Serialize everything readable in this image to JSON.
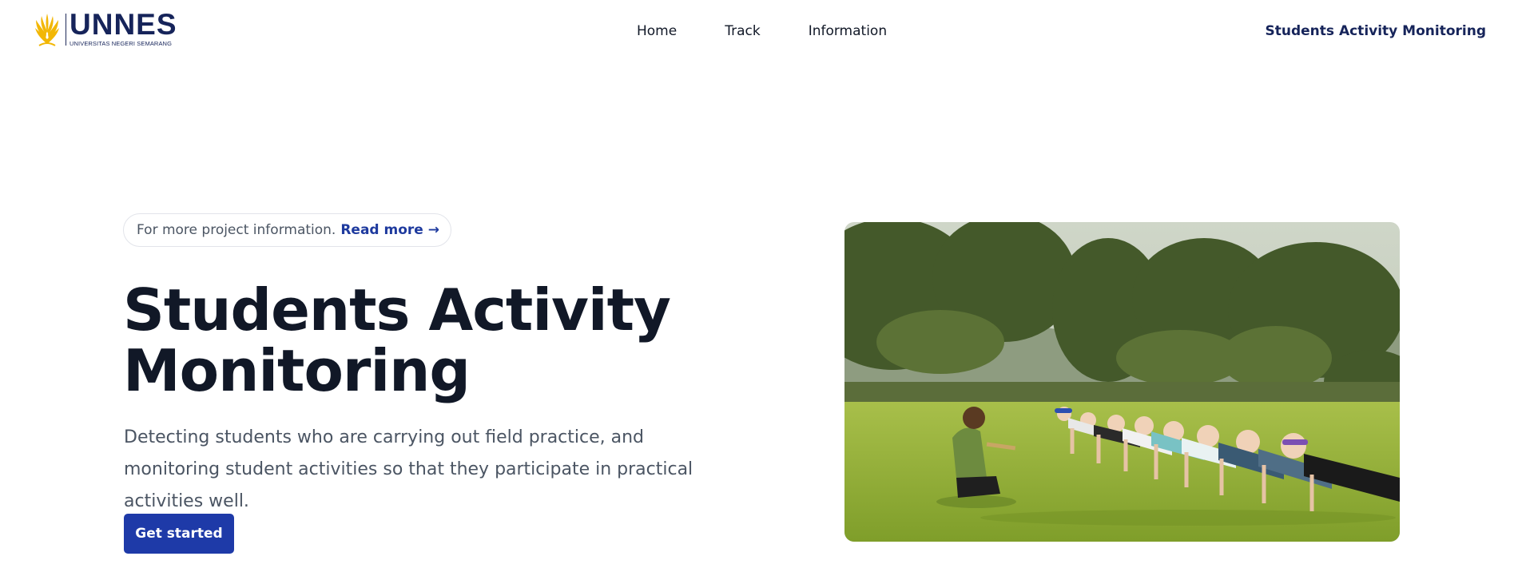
{
  "header": {
    "logo": {
      "word": "UNNES",
      "subtitle": "UNIVERSITAS NEGERI SEMARANG"
    },
    "nav": [
      {
        "label": "Home"
      },
      {
        "label": "Track"
      },
      {
        "label": "Information"
      }
    ],
    "brand_right": "Students Activity Monitoring"
  },
  "hero": {
    "announcement": {
      "text": "For more project information.",
      "link_label": "Read more →"
    },
    "title": "Students Activity Monitoring",
    "subtitle": "Detecting students who are carrying out field practice, and monitoring student activities so that they participate in practical activities well.",
    "cta_label": "Get started",
    "image": {
      "icon": "photo-outdoor-group-exercise"
    }
  },
  "colors": {
    "brand_navy": "#16245a",
    "primary_button": "#1e3aa8",
    "link_blue": "#1e3a9e",
    "logo_gold": "#f2b705"
  }
}
